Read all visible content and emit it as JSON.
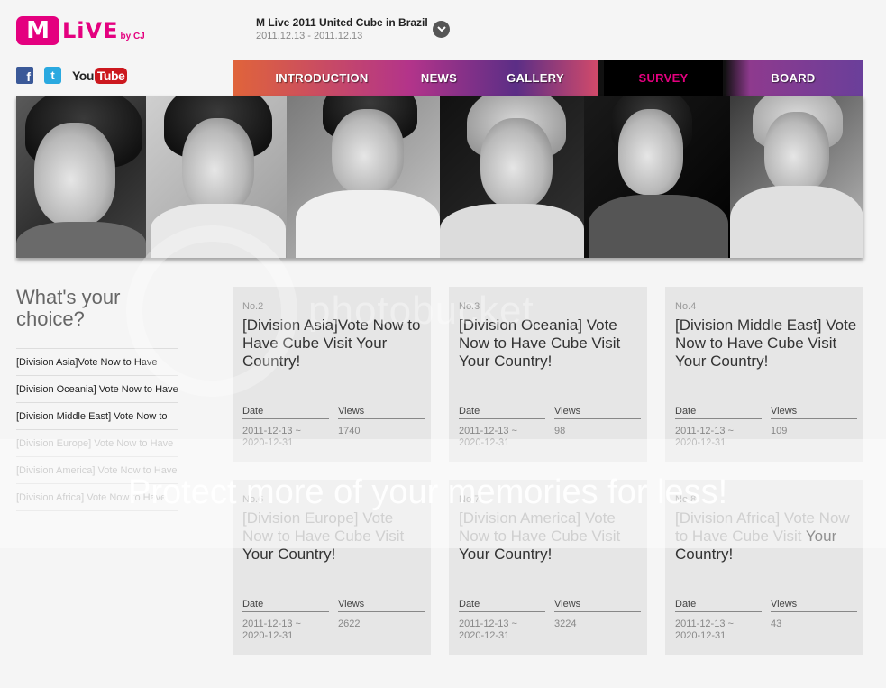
{
  "brand": {
    "logo_m": "M",
    "logo_live": "LiVE",
    "logo_by": "by CJ"
  },
  "event": {
    "title": "M Live 2011 United Cube in Brazil",
    "dates": "2011.12.13 - 2011.12.13"
  },
  "social": {
    "facebook": "f",
    "twitter": "t",
    "youtube_you": "You",
    "youtube_tube": "Tube"
  },
  "nav": {
    "items": [
      {
        "label": "INTRODUCTION"
      },
      {
        "label": "NEWS"
      },
      {
        "label": "GALLERY"
      },
      {
        "label": "SURVEY",
        "active": true
      },
      {
        "label": "BOARD"
      }
    ]
  },
  "sidebar": {
    "title": "What's your choice?",
    "items": [
      {
        "label": "[Division Asia]Vote Now to Have"
      },
      {
        "label": "[Division Oceania] Vote Now to Have"
      },
      {
        "label": "[Division Middle East] Vote Now to"
      },
      {
        "label": "[Division Europe] Vote Now to Have"
      },
      {
        "label": "[Division America] Vote Now to Have"
      },
      {
        "label": "[Division Africa] Vote Now to Have"
      }
    ]
  },
  "cards": [
    {
      "no": "No.2",
      "title": "[Division Asia]Vote Now to Have Cube Visit Your Country!",
      "date_label": "Date",
      "date_value": "2011-12-13 ~ 2020-12-31",
      "views_label": "Views",
      "views_value": "1740"
    },
    {
      "no": "No.3",
      "title": "[Division Oceania] Vote Now to Have Cube Visit Your Country!",
      "date_label": "Date",
      "date_value": "2011-12-13 ~ 2020-12-31",
      "views_label": "Views",
      "views_value": "98"
    },
    {
      "no": "No.4",
      "title": "[Division Middle East] Vote Now to Have Cube Visit Your Country!",
      "date_label": "Date",
      "date_value": "2011-12-13 ~ 2020-12-31",
      "views_label": "Views",
      "views_value": "109"
    },
    {
      "no": "No.6",
      "title_top": "[Division Europe] Vote Now to Have Cube Visit",
      "title_bottom": "Your Country!",
      "date_label": "Date",
      "date_value": "2011-12-13 ~ 2020-12-31",
      "views_label": "Views",
      "views_value": "2622"
    },
    {
      "no": "No.7",
      "title_top": "[Division America] Vote Now to Have Cube Visit",
      "title_bottom": "Your Country!",
      "date_label": "Date",
      "date_value": "2011-12-13 ~ 2020-12-31",
      "views_label": "Views",
      "views_value": "3224"
    },
    {
      "no": "No.8",
      "title_top": "[Division Africa] Vote Now to Have Cube Visit",
      "title_bottom": "Your Country!",
      "date_label": "Date",
      "date_value": "2011-12-13 ~ 2020-12-31",
      "views_label": "Views",
      "views_value": "43"
    }
  ],
  "watermark": {
    "text": "Protect more of your memories for less!",
    "logo": "photobucket"
  },
  "icons": {
    "toggle": "chevron-down-icon"
  },
  "colors": {
    "brand_pink": "#e4007f",
    "card_bg": "#e6e6e6"
  }
}
